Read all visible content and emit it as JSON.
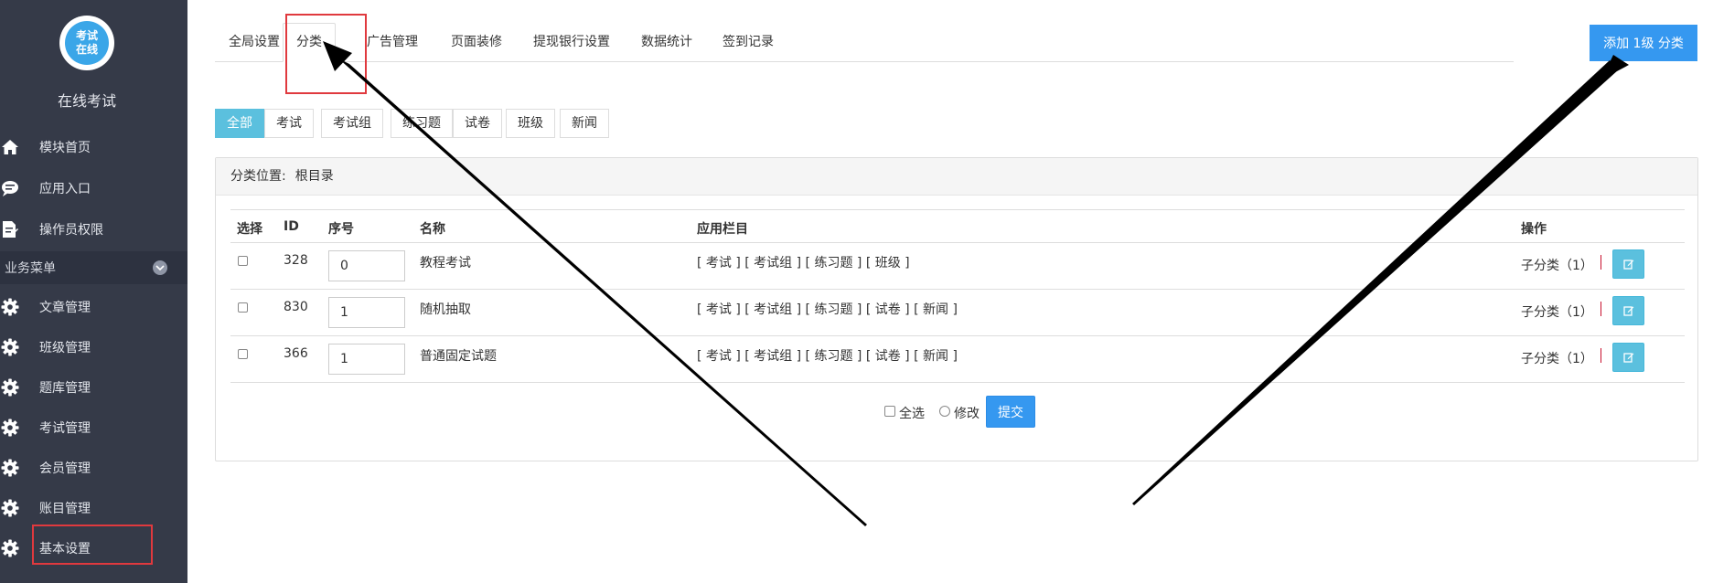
{
  "sidebar": {
    "logo_text_line1": "考试",
    "logo_text_line2": "在线",
    "app_name": "在线考试",
    "top_items": [
      {
        "label": "模块首页",
        "icon": "home-icon"
      },
      {
        "label": "应用入口",
        "icon": "chat-icon"
      },
      {
        "label": "操作员权限",
        "icon": "document-edit-icon"
      }
    ],
    "section_label": "业务菜单",
    "menu_items": [
      {
        "label": "文章管理",
        "icon": "gear-icon"
      },
      {
        "label": "班级管理",
        "icon": "gear-icon"
      },
      {
        "label": "题库管理",
        "icon": "gear-icon"
      },
      {
        "label": "考试管理",
        "icon": "gear-icon"
      },
      {
        "label": "会员管理",
        "icon": "gear-icon"
      },
      {
        "label": "账目管理",
        "icon": "gear-icon"
      },
      {
        "label": "基本设置",
        "icon": "gear-icon"
      }
    ]
  },
  "tabs": [
    "全局设置",
    "分类",
    "广告管理",
    "页面装修",
    "提现银行设置",
    "数据统计",
    "签到记录"
  ],
  "active_tab": "分类",
  "add_button_label": "添加 1级 分类",
  "filters": [
    "全部",
    "考试",
    "考试组",
    "练习题",
    "试卷",
    "班级",
    "新闻"
  ],
  "panel": {
    "location_label": "分类位置:",
    "location_value": "根目录"
  },
  "table": {
    "headers": {
      "select": "选择",
      "id": "ID",
      "order": "序号",
      "name": "名称",
      "columns": "应用栏目",
      "action": "操作"
    },
    "rows": [
      {
        "id": "328",
        "order": "0",
        "name": "教程考试",
        "columns": "[ 考试 ] [ 考试组 ] [ 练习题 ] [ 班级 ]",
        "sub": "子分类（1）"
      },
      {
        "id": "830",
        "order": "1",
        "name": "随机抽取",
        "columns": "[ 考试 ] [ 考试组 ] [ 练习题 ] [ 试卷 ] [ 新闻 ]",
        "sub": "子分类（1）"
      },
      {
        "id": "366",
        "order": "1",
        "name": "普通固定试题",
        "columns": "[ 考试 ] [ 考试组 ] [ 练习题 ] [ 试卷 ] [ 新闻 ]",
        "sub": "子分类（1）"
      }
    ]
  },
  "footer": {
    "select_all_label": "全选",
    "modify_label": "修改",
    "submit_label": "提交"
  },
  "colors": {
    "sidebar_bg": "#353a48",
    "primary": "#3598f0",
    "info": "#5bc0de",
    "highlight": "#e0393e"
  }
}
